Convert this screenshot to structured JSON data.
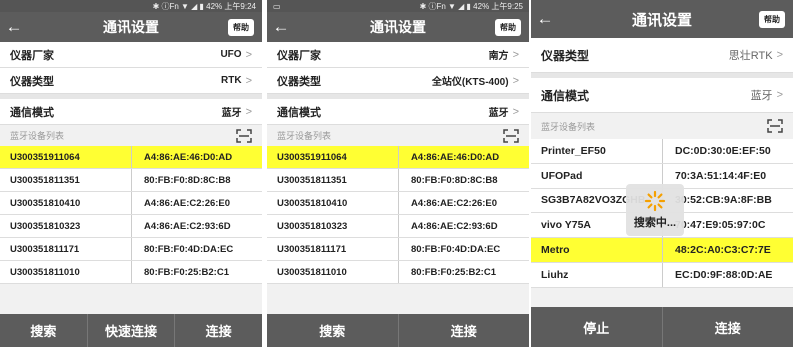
{
  "screens": [
    {
      "status": {
        "left": "",
        "right": "✱ ⓘFn ▼ ◢ ▮ 42% 上午9:24"
      },
      "title": "通讯设置",
      "help_label": "帮助",
      "settings": [
        {
          "label": "仪器厂家",
          "value": "UFO"
        },
        {
          "label": "仪器类型",
          "value": "RTK"
        },
        {
          "label": "通信模式",
          "value": "蓝牙"
        }
      ],
      "list_header": "蓝牙设备列表",
      "devices": [
        {
          "name": "U300351911064",
          "mac": "A4:86:AE:46:D0:AD",
          "selected": true
        },
        {
          "name": "U300351811351",
          "mac": "80:FB:F0:8D:8C:B8"
        },
        {
          "name": "U300351810410",
          "mac": "A4:86:AE:C2:26:E0"
        },
        {
          "name": "U300351810323",
          "mac": "A4:86:AE:C2:93:6D"
        },
        {
          "name": "U300351811171",
          "mac": "80:FB:F0:4D:DA:EC"
        },
        {
          "name": "U300351811010",
          "mac": "80:FB:F0:25:B2:C1"
        }
      ],
      "buttons": [
        "搜索",
        "快速连接",
        "连接"
      ]
    },
    {
      "status": {
        "left": "▭",
        "right": "✱ ⓘFn ▼ ◢ ▮ 42% 上午9:25"
      },
      "title": "通讯设置",
      "help_label": "帮助",
      "settings": [
        {
          "label": "仪器厂家",
          "value": "南方"
        },
        {
          "label": "仪器类型",
          "value": "全站仪(KTS-400)"
        },
        {
          "label": "通信模式",
          "value": "蓝牙"
        }
      ],
      "list_header": "蓝牙设备列表",
      "devices": [
        {
          "name": "U300351911064",
          "mac": "A4:86:AE:46:D0:AD",
          "selected": true
        },
        {
          "name": "U300351811351",
          "mac": "80:FB:F0:8D:8C:B8"
        },
        {
          "name": "U300351810410",
          "mac": "A4:86:AE:C2:26:E0"
        },
        {
          "name": "U300351810323",
          "mac": "A4:86:AE:C2:93:6D"
        },
        {
          "name": "U300351811171",
          "mac": "80:FB:F0:4D:DA:EC"
        },
        {
          "name": "U300351811010",
          "mac": "80:FB:F0:25:B2:C1"
        }
      ],
      "buttons": [
        "搜索",
        "连接"
      ]
    },
    {
      "title": "通讯设置",
      "help_label": "帮助",
      "settings": [
        {
          "label": "仪器类型",
          "value": "思壮RTK"
        },
        {
          "label": "通信模式",
          "value": "蓝牙"
        }
      ],
      "list_header": "蓝牙设备列表",
      "devices": [
        {
          "name": "Printer_EF50",
          "mac": "DC:0D:30:0E:EF:50"
        },
        {
          "name": "UFOPad",
          "mac": "70:3A:51:14:4F:E0"
        },
        {
          "name": "SG3B7A82VO3ZGHB",
          "mac": "30:52:CB:9A:8F:BB"
        },
        {
          "name": "vivo Y75A",
          "mac": "70:47:E9:05:97:0C"
        },
        {
          "name": "Metro",
          "mac": "48:2C:A0:C3:C7:7E",
          "selected": true
        },
        {
          "name": "Liuhz",
          "mac": "EC:D0:9F:88:0D:AE"
        }
      ],
      "loading_text": "搜索中...",
      "buttons": [
        "停止",
        "连接"
      ]
    }
  ],
  "colors": {
    "bar": "#5c5c5c",
    "selected_row": "#ffff33",
    "spinner": "#f5a000"
  },
  "icons": {
    "back": "arrow-left-icon",
    "chevron": "chevron-right-icon",
    "scan": "scan-frame-icon",
    "spinner": "spinner-icon"
  }
}
